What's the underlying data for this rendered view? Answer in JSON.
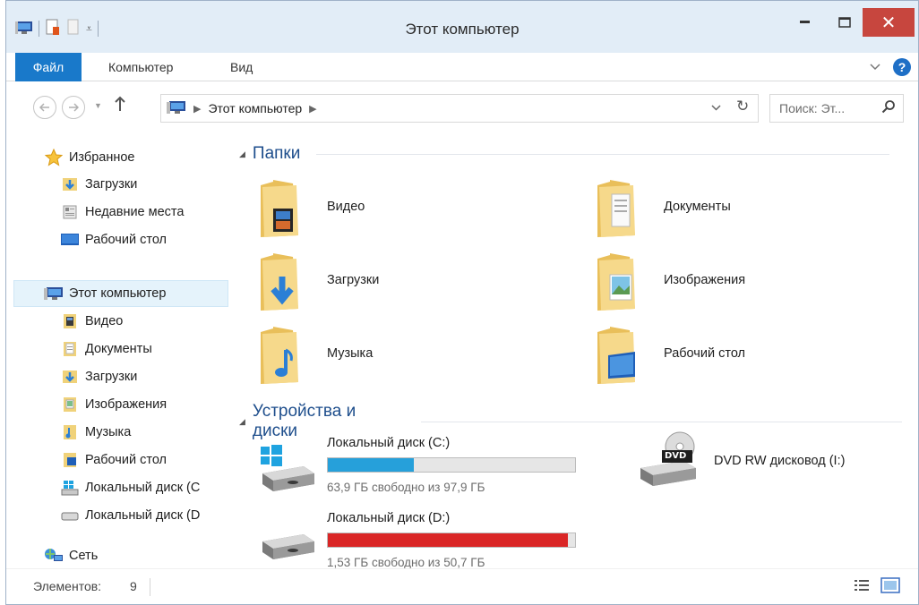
{
  "window": {
    "title": "Этот компьютер",
    "close_glyph": "✕"
  },
  "ribbon": {
    "tabs": [
      "Файл",
      "Компьютер",
      "Вид"
    ]
  },
  "nav": {
    "breadcrumb": [
      "Этот компьютер"
    ],
    "search_placeholder": "Поиск: Эт..."
  },
  "sidebar": {
    "favorites": {
      "label": "Избранное",
      "items": [
        "Загрузки",
        "Недавние места",
        "Рабочий стол"
      ]
    },
    "this_pc": {
      "label": "Этот компьютер",
      "selected": true,
      "items": [
        "Видео",
        "Документы",
        "Загрузки",
        "Изображения",
        "Музыка",
        "Рабочий стол",
        "Локальный диск (C",
        "Локальный диск (D"
      ]
    },
    "network": {
      "label": "Сеть"
    }
  },
  "main": {
    "folders_group": "Папки",
    "folders": [
      {
        "name": "Видео",
        "icon": "video-folder-icon"
      },
      {
        "name": "Документы",
        "icon": "documents-folder-icon"
      },
      {
        "name": "Загрузки",
        "icon": "downloads-folder-icon"
      },
      {
        "name": "Изображения",
        "icon": "pictures-folder-icon"
      },
      {
        "name": "Музыка",
        "icon": "music-folder-icon"
      },
      {
        "name": "Рабочий стол",
        "icon": "desktop-folder-icon"
      }
    ],
    "devices_group": "Устройства и диски",
    "drives": [
      {
        "name": "Локальный диск (C:)",
        "free": "63,9 ГБ свободно из 97,9 ГБ",
        "used_fraction": 0.347,
        "bar_color": "#26a0da"
      },
      {
        "name": "Локальный диск (D:)",
        "free": "1,53 ГБ свободно из 50,7 ГБ",
        "used_fraction": 0.97,
        "bar_color": "#da2626"
      }
    ],
    "dvd": {
      "name": "DVD RW дисковод (I:)",
      "badge": "DVD"
    }
  },
  "status": {
    "items_label": "Элементов:",
    "items_count": "9"
  }
}
